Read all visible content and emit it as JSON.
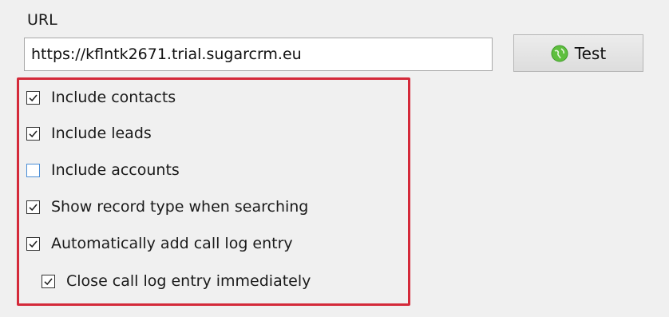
{
  "url": {
    "label": "URL",
    "value": "https://kflntk2671.trial.sugarcrm.eu"
  },
  "test_button": {
    "label": "Test",
    "icon": "globe-icon",
    "icon_color": "#5fbf3f"
  },
  "highlight_color": "#d42a3a",
  "options": [
    {
      "label": "Include contacts",
      "checked": true
    },
    {
      "label": "Include leads",
      "checked": true
    },
    {
      "label": "Include accounts",
      "checked": false
    },
    {
      "label": "Show record type when searching",
      "checked": true
    },
    {
      "label": "Automatically add call log entry",
      "checked": true
    },
    {
      "label": "Close call log entry immediately",
      "checked": true
    }
  ]
}
